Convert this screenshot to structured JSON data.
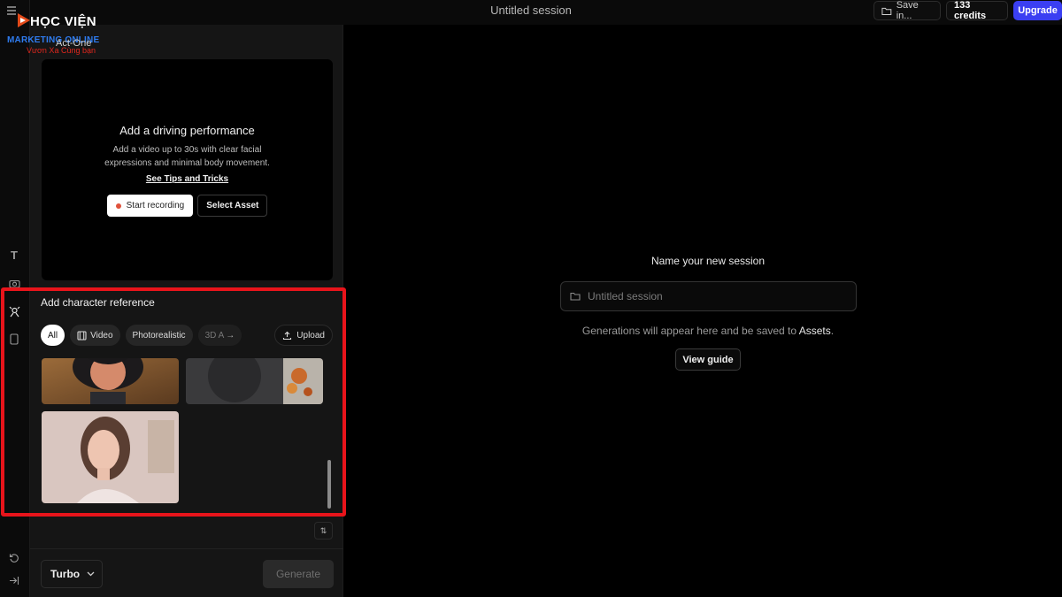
{
  "app": {
    "session_title": "Untitled session",
    "save_label": "Save in...",
    "credits_label": "133 credits",
    "upgrade_label": "Upgrade"
  },
  "logo": {
    "title": "HỌC VIỆN",
    "subtitle": "MARKETING ONLINE",
    "tagline": "Vươn Xa Cùng bạn"
  },
  "tool": {
    "name": "Act-One"
  },
  "driving": {
    "heading": "Add a driving performance",
    "description": "Add a video up to 30s with clear facial expressions and minimal body movement.",
    "tips_link": "See Tips and Tricks",
    "record_label": "Start recording",
    "select_asset_label": "Select Asset"
  },
  "character": {
    "heading": "Add character reference",
    "filters": [
      "All",
      "Video",
      "Photorealistic",
      "3D A"
    ],
    "upload_label": "Upload",
    "thumbnails": [
      "character-thumb-1",
      "character-thumb-2",
      "character-thumb-3"
    ]
  },
  "footer": {
    "model_label": "Turbo",
    "generate_label": "Generate"
  },
  "session": {
    "heading": "Name your new session",
    "input_placeholder": "Untitled session",
    "note_prefix": "Generations will appear here and be saved to ",
    "note_link": "Assets",
    "note_suffix": ".",
    "guide_label": "View guide"
  },
  "colors": {
    "accent": "#3b3ff2",
    "highlight": "#e8141b",
    "record_dot": "#e0523c"
  },
  "icons": [
    "menu-icon",
    "text-icon",
    "camera-icon",
    "act-one-icon",
    "device-icon",
    "history-icon",
    "collapse-icon",
    "folder-icon",
    "film-icon",
    "upload-icon",
    "arrow-right-icon",
    "sort-icon",
    "chevron-down-icon"
  ]
}
